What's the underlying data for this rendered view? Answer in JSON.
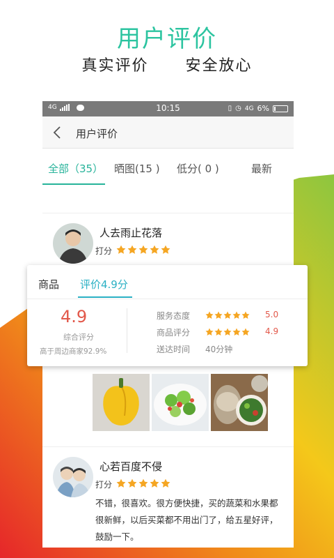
{
  "promo": {
    "title": "用户评价",
    "subtitle_left": "真实评价",
    "subtitle_right": "安全放心"
  },
  "statusbar": {
    "network": "4G",
    "time": "10:15",
    "battery": "6%",
    "right_network": "4G"
  },
  "navbar": {
    "title": "用户评价"
  },
  "tabs": [
    {
      "label": "全部（35）",
      "active": true
    },
    {
      "label": "晒图(15 )",
      "active": false
    },
    {
      "label": "低分( 0 )",
      "active": false
    },
    {
      "label": "最新",
      "active": false
    }
  ],
  "reviews": [
    {
      "user": "人去雨止花落",
      "score_label": "打分",
      "rating": 5,
      "text": ""
    },
    {
      "user": "心若百度不侵",
      "score_label": "打分",
      "rating": 5,
      "text_lines": [
        "不错，很喜欢。很方便快捷，买的蔬菜和水果都",
        "很新鲜，以后买菜都不用出门了，给五星好评，",
        "鼓励一下。"
      ]
    }
  ],
  "photos": [
    "yellow-pepper-photo",
    "salad-photo",
    "salad-bowls-photo"
  ],
  "rating_card": {
    "tab_goods": "商品",
    "tab_rating": "评价4.9分",
    "overall_score": "4.9",
    "overall_label": "综合评分",
    "compare_text": "高于周边商家92.9%",
    "rows": [
      {
        "label": "服务态度",
        "stars": 5,
        "value": "5.0"
      },
      {
        "label": "商品评分",
        "stars": 5,
        "value": "4.9"
      },
      {
        "label": "送达时间",
        "text": "40分钟"
      }
    ]
  },
  "colors": {
    "accent_green": "#2cc4a0",
    "accent_blue": "#2ab0c4",
    "star_orange": "#f5a623",
    "score_red": "#e2584a"
  }
}
